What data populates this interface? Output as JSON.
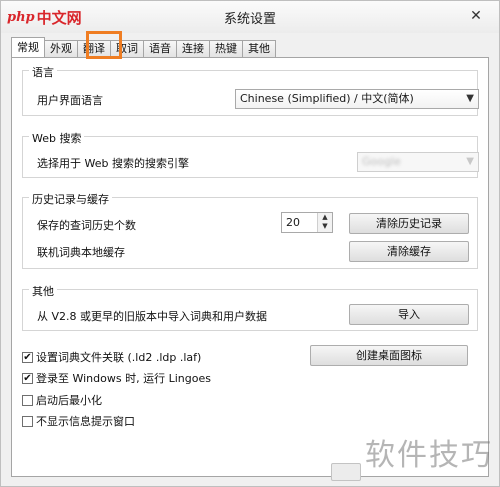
{
  "window": {
    "title": "系统设置",
    "logo_php": "php",
    "logo_cn": "中文网",
    "close_glyph": "✕"
  },
  "tabs": [
    {
      "label": "常规",
      "active": true
    },
    {
      "label": "外观"
    },
    {
      "label": "翻译"
    },
    {
      "label": "取词"
    },
    {
      "label": "语音"
    },
    {
      "label": "连接"
    },
    {
      "label": "热键"
    },
    {
      "label": "其他"
    }
  ],
  "language": {
    "group_title": "语言",
    "ui_language_label": "用户界面语言",
    "ui_language_value": "Chinese (Simplified)  /  中文(简体)"
  },
  "web_search": {
    "group_title": "Web 搜索",
    "engine_label": "选择用于 Web 搜索的搜索引擎",
    "engine_value": "Google"
  },
  "history": {
    "group_title": "历史记录与缓存",
    "count_label": "保存的查词历史个数",
    "count_value": "20",
    "clear_history_button": "清除历史记录",
    "cache_label": "联机词典本地缓存",
    "clear_cache_button": "清除缓存"
  },
  "other": {
    "group_title": "其他",
    "import_label": "从 V2.8 或更早的旧版本中导入词典和用户数据",
    "import_button": "导入"
  },
  "options": {
    "assoc_label": "设置词典文件关联 (.ld2 .ldp .laf)",
    "assoc_checked": true,
    "create_shortcut_button": "创建桌面图标",
    "login_label": "登录至 Windows 时, 运行 Lingoes",
    "login_checked": true,
    "minimize_label": "启动后最小化",
    "minimize_checked": false,
    "no_tips_label": "不显示信息提示窗口",
    "no_tips_checked": false
  },
  "watermark": "软件技巧"
}
